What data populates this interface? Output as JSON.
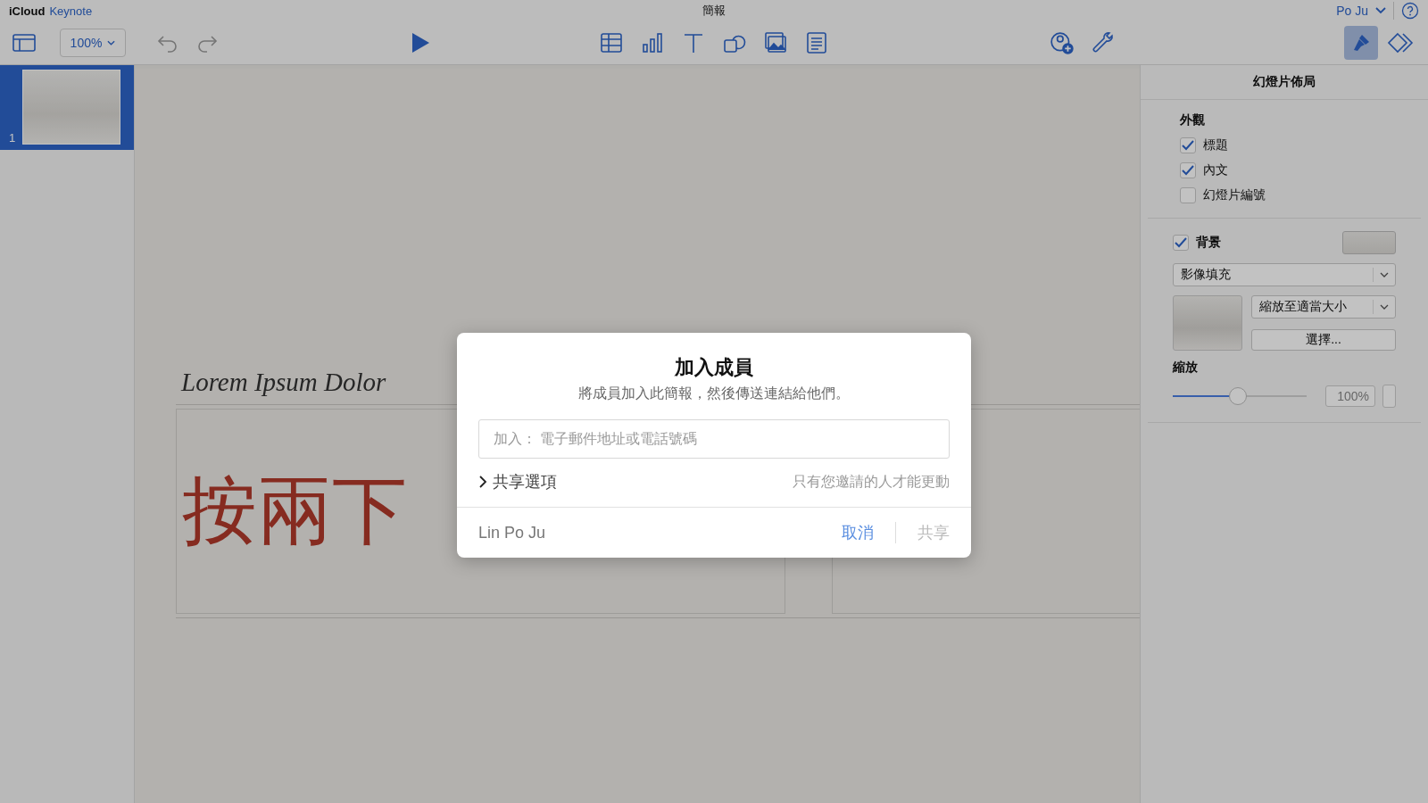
{
  "app": {
    "brand": "iCloud",
    "product": "Keynote"
  },
  "window": {
    "title": "簡報"
  },
  "account": {
    "name": "Po Ju"
  },
  "toolbar": {
    "zoom": "100%",
    "inspector_tabs": [
      {
        "kind": "format",
        "selected": true
      },
      {
        "kind": "animate",
        "selected": false
      }
    ]
  },
  "slides": [
    {
      "number": "1",
      "selected": true
    }
  ],
  "slide": {
    "title": "Lorem Ipsum Dolor",
    "body": "按兩下"
  },
  "inspector": {
    "title": "幻燈片佈局",
    "appearance_label": "外觀",
    "options": [
      {
        "label": "標題",
        "checked": true
      },
      {
        "label": "內文",
        "checked": true
      },
      {
        "label": "幻燈片編號",
        "checked": false
      }
    ],
    "background": {
      "label": "背景",
      "checked": true
    },
    "fill_type": "影像填充",
    "image_scale": "縮放至適當大小",
    "choose_button": "選擇...",
    "scale_label": "縮放",
    "scale": {
      "level": 0.48,
      "reading": "100%"
    }
  },
  "dialog": {
    "title": "加入成員",
    "subtitle": "將成員加入此簡報，然後傳送連結給他們。",
    "placeholder": "加入： 電子郵件地址或電話號碼",
    "options_label": "共享選項",
    "permission": "只有您邀請的人才能更動",
    "owner": "Lin Po Ju",
    "cancel": "取消",
    "share": {
      "label": "共享",
      "disabled": true
    }
  }
}
